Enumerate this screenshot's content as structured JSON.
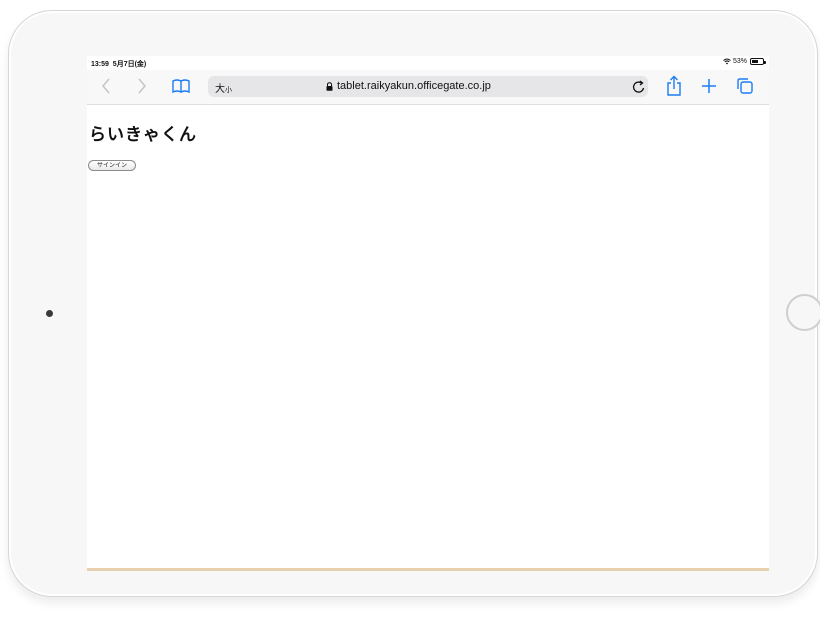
{
  "status_bar": {
    "time": "13:59",
    "date": "5月7日(金)",
    "battery": "53%"
  },
  "toolbar": {
    "text_size_large": "大",
    "text_size_small": "小",
    "url": "tablet.raikyakun.officegate.co.jp",
    "icons": [
      "chevron-left-icon",
      "chevron-right-icon",
      "bookmarks-icon",
      "lock-icon",
      "reload-icon",
      "share-icon",
      "plus-icon",
      "tabs-icon"
    ],
    "accent_color": "#1a7cf5"
  },
  "page": {
    "title": "らいきゃくん",
    "signin_label": "サインイン"
  }
}
